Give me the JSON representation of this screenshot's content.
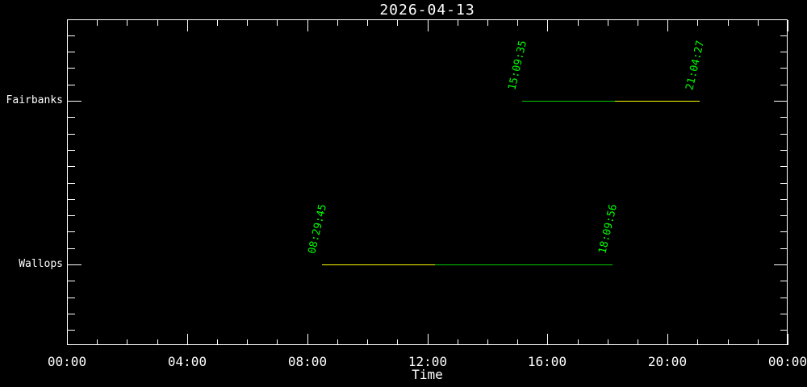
{
  "chart_data": {
    "type": "gantt",
    "title": "2026-04-13",
    "xlabel": "Time",
    "x_range_hours": [
      0,
      24
    ],
    "x_major_tick_labels": [
      "00:00",
      "04:00",
      "08:00",
      "12:00",
      "16:00",
      "20:00",
      "00:00"
    ],
    "x_major_tick_interval_hours": 4,
    "x_minor_tick_interval_hours": 1,
    "grid": "off",
    "categories": [
      "Fairbanks",
      "Wallops"
    ],
    "passes": [
      {
        "station": "Fairbanks",
        "aos": "15:09:35",
        "los": "21:04:27",
        "segments": [
          {
            "start_hour": 15.16,
            "end_hour": 18.25,
            "color": "#00cc00"
          },
          {
            "start_hour": 18.25,
            "end_hour": 21.074,
            "color": "#ffff00"
          }
        ]
      },
      {
        "station": "Wallops",
        "aos": "08:29:45",
        "los": "18:09:56",
        "segments": [
          {
            "start_hour": 8.496,
            "end_hour": 12.25,
            "color": "#ffff00"
          },
          {
            "start_hour": 12.25,
            "end_hour": 18.166,
            "color": "#00cc00"
          }
        ]
      }
    ],
    "colors": {
      "background": "#000000",
      "frame": "#ffffff",
      "text": "#ffffff",
      "pass_time_label": "#00ff00",
      "pass_green": "#00cc00",
      "pass_yellow": "#ffff00"
    }
  }
}
